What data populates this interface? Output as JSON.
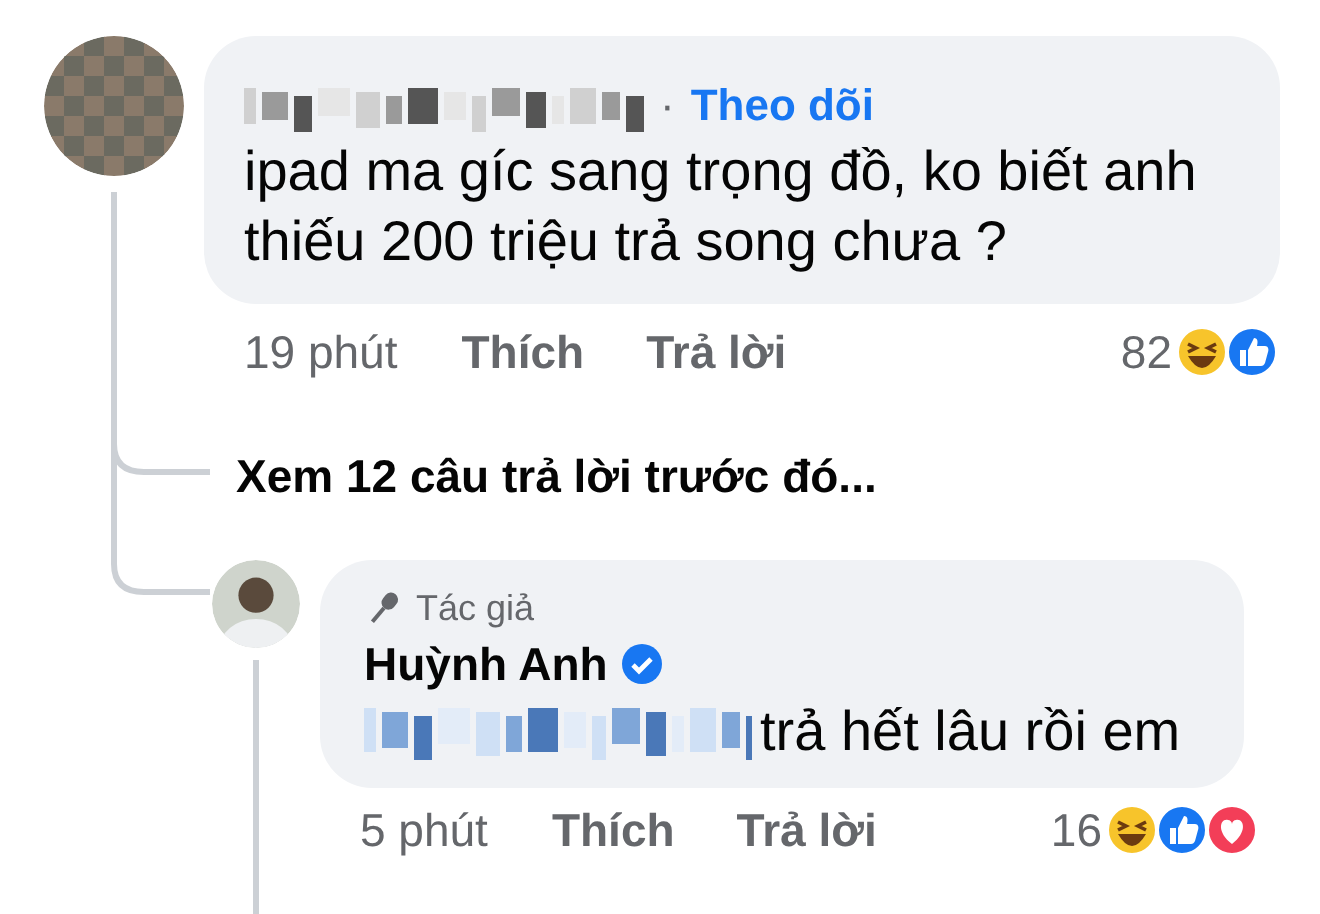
{
  "comment": {
    "author_redacted": true,
    "separator": "·",
    "follow": "Theo dõi",
    "text": "ipad ma gíc sang trọng đồ, ko biết anh\nthiếu 200 triệu trả song chưa ?",
    "time": "19 phút",
    "like": "Thích",
    "reply": "Trả lời",
    "reaction_count": "82",
    "reactions": [
      {
        "kind": "haha"
      },
      {
        "kind": "like"
      }
    ]
  },
  "more_replies": "Xem 12 câu trả lời trước đó...",
  "reply": {
    "badge": "Tác giả",
    "author": "Huỳnh Anh",
    "verified": true,
    "mention_redacted": true,
    "text": "trả hết lâu rồi em",
    "time": "5 phút",
    "like": "Thích",
    "reply": "Trả lời",
    "reaction_count": "16",
    "reactions": [
      {
        "kind": "haha"
      },
      {
        "kind": "like"
      },
      {
        "kind": "love"
      }
    ]
  }
}
